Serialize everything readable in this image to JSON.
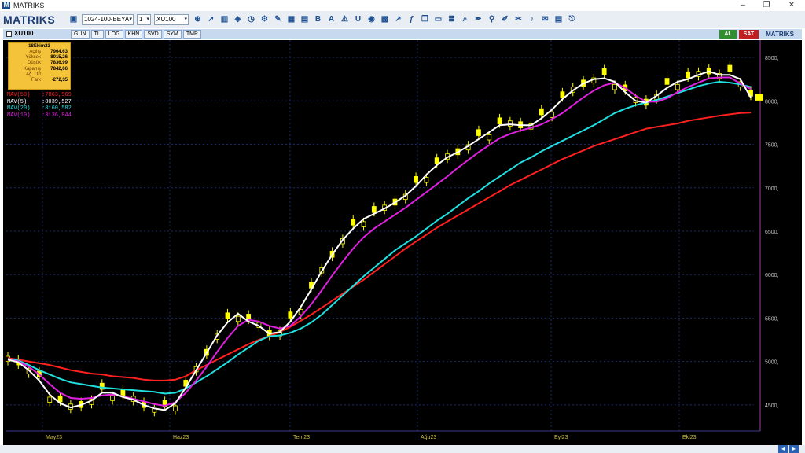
{
  "window": {
    "title": "MATRIKS",
    "logo_letter": "M"
  },
  "toolbar": {
    "brand": "MATRIKS",
    "template_select": "1024-100-BEYA",
    "count_select": "1",
    "symbol_select": "XU100",
    "icons": [
      "zoom-icon",
      "cursor-icon",
      "chart-type-icon",
      "indicator-icon",
      "clock-icon",
      "settings-icon",
      "drawing-icon",
      "table-icon",
      "layers-icon",
      "bold-icon",
      "text-icon",
      "alert-icon",
      "undo-icon",
      "info-icon",
      "grid-icon",
      "trend-icon",
      "formula-icon",
      "window-icon",
      "monitor-icon",
      "list-icon",
      "search-icon",
      "pen-icon",
      "link-icon",
      "edit-icon",
      "tools-icon",
      "volume-icon",
      "mail-icon",
      "data-icon",
      "exit-icon"
    ]
  },
  "chart_window": {
    "symbol": "XU100",
    "tabs": [
      "GUN",
      "TL",
      "LOG",
      "KHN",
      "SVD",
      "SYM",
      "TMP"
    ],
    "buy_label": "AL",
    "sell_label": "SAT",
    "brand": "MATRIKS"
  },
  "infobox": {
    "date": "18Ekim23",
    "rows": [
      {
        "label": "Açılış",
        "value": "7964,63"
      },
      {
        "label": "Yüksek",
        "value": "8015,26"
      },
      {
        "label": "Düşük",
        "value": "7836,99"
      },
      {
        "label": "Kapanış",
        "value": "7842,66"
      },
      {
        "label": "Ağ. Ort",
        "value": ""
      },
      {
        "label": "Fark",
        "value": "-272,35"
      }
    ]
  },
  "legend": [
    {
      "name": "MAV(50)",
      "value": ":7863,969",
      "color": "#ff2020"
    },
    {
      "name": "MAV(5)",
      "value": ":8039,527",
      "color": "#ffffff"
    },
    {
      "name": "MAV(20)",
      "value": ":8160,582",
      "color": "#20e0e0"
    },
    {
      "name": "MAV(10)",
      "value": ":8136,844",
      "color": "#e020e0"
    }
  ],
  "chart_data": {
    "type": "line",
    "xlabel": "",
    "ylabel": "",
    "x_ticks": [
      "May23",
      "Haz23",
      "Tem23",
      "Ağu23",
      "Eyl23",
      "Eki23"
    ],
    "y_ticks": [
      "4500,",
      "5000,",
      "5500,",
      "6000,",
      "6500,",
      "7000,",
      "7500,",
      "8000,",
      "8500,"
    ],
    "ylim": [
      4200,
      8700
    ],
    "grid": true,
    "candle_color": "#ffff00",
    "series": [
      {
        "name": "MAV(50)",
        "color": "#ff2020",
        "values": [
          5040,
          5020,
          5000,
          4980,
          4960,
          4930,
          4900,
          4880,
          4860,
          4850,
          4830,
          4820,
          4810,
          4790,
          4780,
          4780,
          4790,
          4830,
          4900,
          4960,
          5020,
          5080,
          5140,
          5200,
          5250,
          5290,
          5340,
          5400,
          5470,
          5540,
          5620,
          5700,
          5780,
          5860,
          5940,
          6030,
          6120,
          6210,
          6300,
          6380,
          6460,
          6540,
          6610,
          6680,
          6750,
          6820,
          6890,
          6960,
          7030,
          7090,
          7150,
          7210,
          7270,
          7330,
          7380,
          7430,
          7480,
          7520,
          7560,
          7600,
          7640,
          7680,
          7700,
          7720,
          7740,
          7770,
          7790,
          7810,
          7830,
          7845,
          7860,
          7864
        ]
      },
      {
        "name": "MAV(5)",
        "color": "#ffffff",
        "values": [
          5020,
          4990,
          4900,
          4780,
          4620,
          4520,
          4470,
          4500,
          4550,
          4640,
          4640,
          4590,
          4560,
          4500,
          4460,
          4440,
          4520,
          4700,
          4900,
          5100,
          5300,
          5450,
          5550,
          5460,
          5410,
          5320,
          5340,
          5460,
          5630,
          5830,
          6040,
          6230,
          6400,
          6530,
          6640,
          6700,
          6760,
          6830,
          6910,
          7020,
          7150,
          7260,
          7350,
          7410,
          7480,
          7560,
          7640,
          7720,
          7730,
          7720,
          7720,
          7800,
          7900,
          8020,
          8120,
          8200,
          8250,
          8260,
          8220,
          8100,
          8000,
          7980,
          8060,
          8150,
          8220,
          8250,
          8300,
          8340,
          8300,
          8300,
          8250,
          8040
        ]
      },
      {
        "name": "MAV(20)",
        "color": "#20e0e0",
        "values": [
          5030,
          5010,
          4960,
          4900,
          4850,
          4800,
          4760,
          4740,
          4720,
          4700,
          4690,
          4680,
          4670,
          4660,
          4650,
          4630,
          4640,
          4690,
          4760,
          4830,
          4910,
          4990,
          5080,
          5160,
          5240,
          5290,
          5300,
          5330,
          5380,
          5450,
          5540,
          5650,
          5760,
          5870,
          5980,
          6080,
          6180,
          6280,
          6360,
          6440,
          6530,
          6620,
          6700,
          6790,
          6880,
          6960,
          7050,
          7130,
          7210,
          7290,
          7350,
          7420,
          7480,
          7540,
          7600,
          7660,
          7720,
          7790,
          7860,
          7910,
          7950,
          7980,
          8010,
          8050,
          8090,
          8130,
          8170,
          8200,
          8220,
          8210,
          8190,
          8160
        ]
      },
      {
        "name": "MAV(10)",
        "color": "#e020e0",
        "values": [
          5020,
          5000,
          4940,
          4850,
          4740,
          4640,
          4580,
          4570,
          4580,
          4610,
          4620,
          4600,
          4570,
          4540,
          4510,
          4490,
          4530,
          4640,
          4780,
          4940,
          5110,
          5270,
          5410,
          5480,
          5460,
          5410,
          5380,
          5410,
          5520,
          5660,
          5820,
          5990,
          6150,
          6300,
          6430,
          6530,
          6610,
          6690,
          6770,
          6860,
          6950,
          7040,
          7130,
          7230,
          7320,
          7410,
          7490,
          7570,
          7620,
          7660,
          7690,
          7730,
          7790,
          7860,
          7950,
          8040,
          8120,
          8180,
          8210,
          8150,
          8060,
          7990,
          7990,
          8030,
          8100,
          8160,
          8210,
          8260,
          8270,
          8270,
          8200,
          8137
        ]
      }
    ]
  },
  "statusbar": {
    "left_btn": "◂",
    "right_btn": "▸"
  }
}
